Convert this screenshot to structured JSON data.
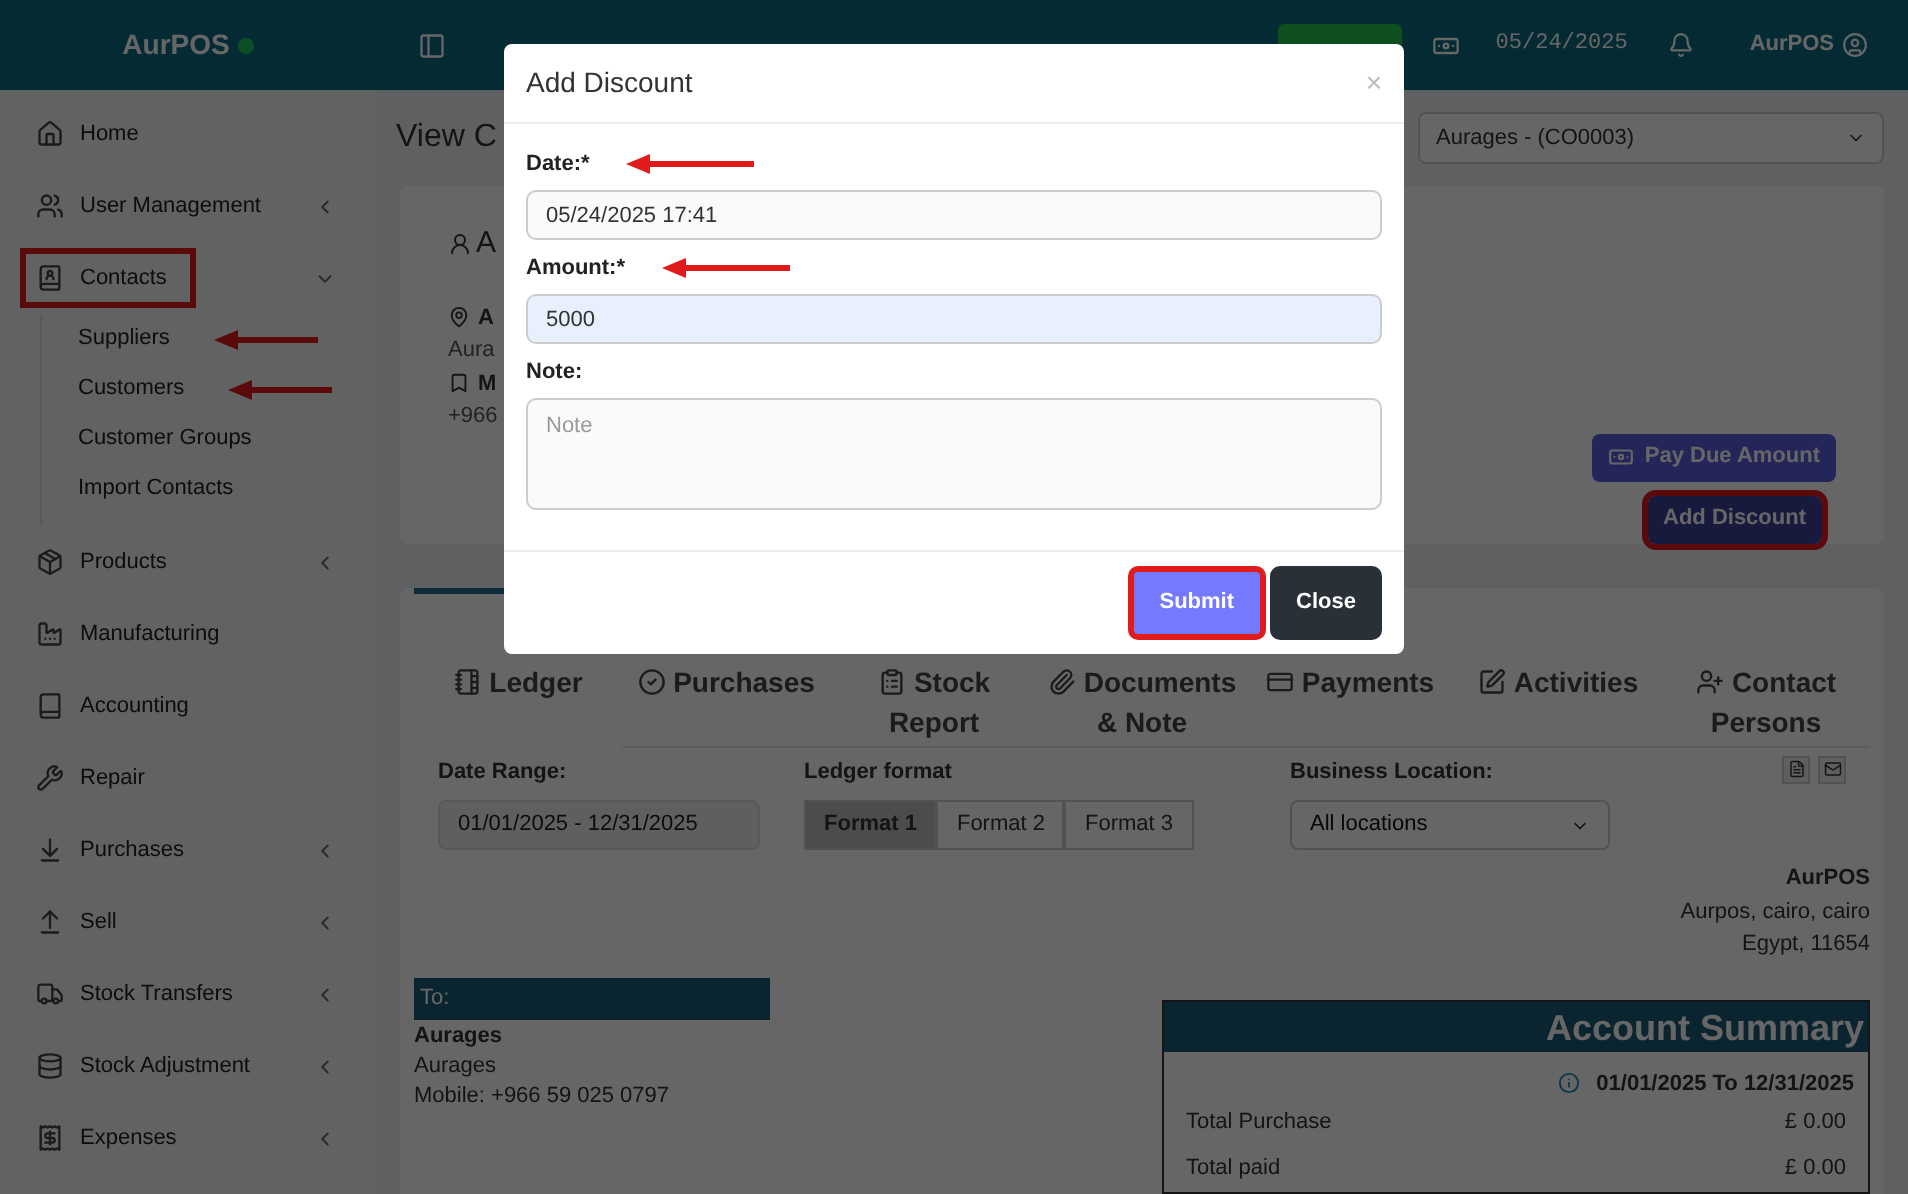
{
  "topbar": {
    "brand": "AurPOS",
    "online": true,
    "date": "05/24/2025",
    "user": "AurPOS"
  },
  "sidebar": {
    "items": [
      {
        "label": "Home",
        "kind": "link",
        "marked": false
      },
      {
        "label": "User Management",
        "kind": "group",
        "expanded": false,
        "marked": false
      },
      {
        "label": "Contacts",
        "kind": "group",
        "expanded": true,
        "marked": true,
        "children": [
          {
            "label": "Suppliers",
            "annotated": true
          },
          {
            "label": "Customers",
            "annotated": true
          },
          {
            "label": "Customer Groups",
            "annotated": false
          },
          {
            "label": "Import Contacts",
            "annotated": false
          }
        ]
      },
      {
        "label": "Products",
        "kind": "group",
        "expanded": false,
        "marked": false
      },
      {
        "label": "Manufacturing",
        "kind": "link",
        "marked": false
      },
      {
        "label": "Accounting",
        "kind": "link",
        "marked": false
      },
      {
        "label": "Repair",
        "kind": "link",
        "marked": false
      },
      {
        "label": "Purchases",
        "kind": "group",
        "expanded": false,
        "marked": false
      },
      {
        "label": "Sell",
        "kind": "group",
        "expanded": false,
        "marked": false
      },
      {
        "label": "Stock Transfers",
        "kind": "group",
        "expanded": false,
        "marked": false
      },
      {
        "label": "Stock Adjustment",
        "kind": "group",
        "expanded": false,
        "marked": false
      },
      {
        "label": "Expenses",
        "kind": "group",
        "expanded": false,
        "marked": false
      }
    ]
  },
  "page": {
    "title": "View C",
    "contact_select": "Aurages - (CO0003)",
    "contact_card": {
      "name": "A",
      "address_label": "A",
      "address": "Aura",
      "mobile_label": "M",
      "mobile": "+966",
      "buttons": [
        {
          "label": "Pay Due Amount",
          "kind": "primary",
          "marked": false
        },
        {
          "label": "Add Discount",
          "kind": "dark",
          "marked": true
        }
      ]
    },
    "tabs": [
      {
        "label": "Ledger",
        "selected": true
      },
      {
        "label": "Purchases",
        "selected": false
      },
      {
        "label": "Stock Report",
        "selected": false
      },
      {
        "label": "Documents & Note",
        "selected": false
      },
      {
        "label": "Payments",
        "selected": false
      },
      {
        "label": "Activities",
        "selected": false
      },
      {
        "label": "Contact Persons",
        "selected": false
      }
    ],
    "filters": {
      "date_range": {
        "label": "Date Range:",
        "value": "01/01/2025 - 12/31/2025"
      },
      "ledger_format": {
        "label": "Ledger format",
        "options": [
          {
            "label": "Format 1",
            "selected": true
          },
          {
            "label": "Format 2",
            "selected": false
          },
          {
            "label": "Format 3",
            "selected": false
          }
        ]
      },
      "business_location": {
        "label": "Business Location:",
        "value": "All locations"
      }
    },
    "business": {
      "name": "AurPOS",
      "lines": [
        "Aurpos, cairo, cairo",
        "Egypt, 11654"
      ]
    },
    "to": {
      "heading": "To:",
      "name": "Aurages",
      "lines": [
        "Aurages",
        "Mobile: +966 59 025 0797"
      ]
    },
    "account_summary": {
      "title": "Account Summary",
      "period": "01/01/2025 To 12/31/2025",
      "rows": [
        {
          "label": "Total Purchase",
          "value": "£ 0.00"
        },
        {
          "label": "Total paid",
          "value": "£ 0.00"
        }
      ]
    }
  },
  "modal": {
    "title": "Add Discount",
    "close": "×",
    "fields": [
      {
        "kind": "text",
        "label": "Date:*",
        "value": "05/24/2025 17:41",
        "annotated": true,
        "highlighted": false
      },
      {
        "kind": "text",
        "label": "Amount:*",
        "value": "5000",
        "annotated": true,
        "highlighted": true
      },
      {
        "kind": "textarea",
        "label": "Note:",
        "placeholder": "Note",
        "annotated": false,
        "highlighted": false
      }
    ],
    "buttons": [
      {
        "label": "Submit",
        "kind": "primary",
        "marked": true
      },
      {
        "label": "Close",
        "kind": "dark",
        "marked": false
      }
    ]
  }
}
